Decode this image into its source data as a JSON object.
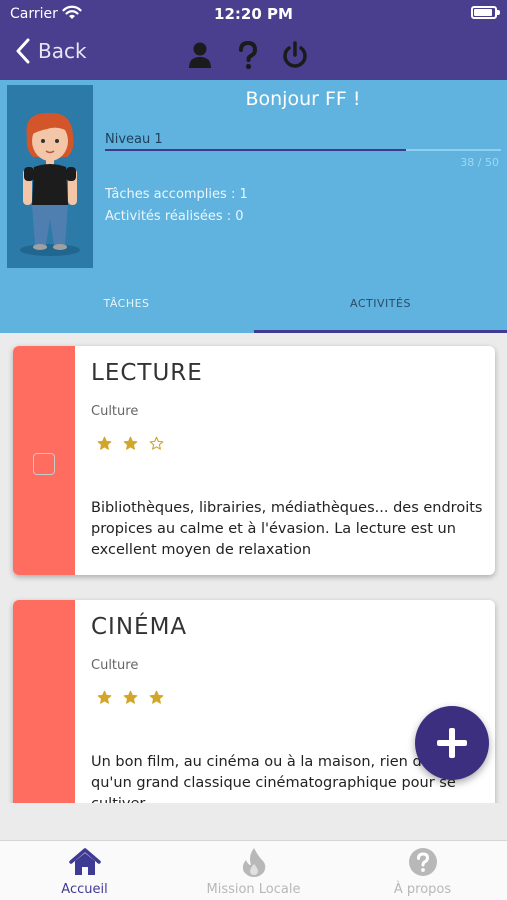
{
  "status_bar": {
    "carrier": "Carrier",
    "time": "12:20 PM"
  },
  "nav": {
    "back_label": "Back",
    "icons": [
      "user-icon",
      "help-icon",
      "power-icon"
    ]
  },
  "profile": {
    "greeting": "Bonjour FF !",
    "level": "Niveau 1",
    "xp_text": "38 / 50",
    "xp_progress": 0.76,
    "tasks_done": "Tâches accomplies : 1",
    "activities_done": "Activités réalisées : 0"
  },
  "tabs": {
    "tasks": "TÂCHES",
    "activities": "ACTIVITÉS",
    "selected": "activities"
  },
  "cards": [
    {
      "title": "LECTURE",
      "category": "Culture",
      "rating": 2,
      "max_rating": 3,
      "checked": false,
      "description": "Bibliothèques, librairies, médiathèques... des endroits propices au calme et à l'évasion. La lecture est un excellent moyen de relaxation"
    },
    {
      "title": "CINÉMA",
      "category": "Culture",
      "rating": 3,
      "max_rating": 3,
      "description": "Un bon film, au cinéma ou à la maison, rien de tel qu'un grand classique cinématographique pour se cultiver"
    }
  ],
  "bottom_tabs": [
    {
      "label": "Accueil",
      "icon": "home-icon",
      "active": true
    },
    {
      "label": "Mission Locale",
      "icon": "flame-icon",
      "active": false
    },
    {
      "label": "À propos",
      "icon": "question-circle-icon",
      "active": false
    }
  ],
  "colors": {
    "header": "#4a3e8f",
    "profile_bg": "#5fb3de",
    "card_stripe": "#ff6d60",
    "accent": "#3f3a93",
    "star": "#d1a62b"
  }
}
